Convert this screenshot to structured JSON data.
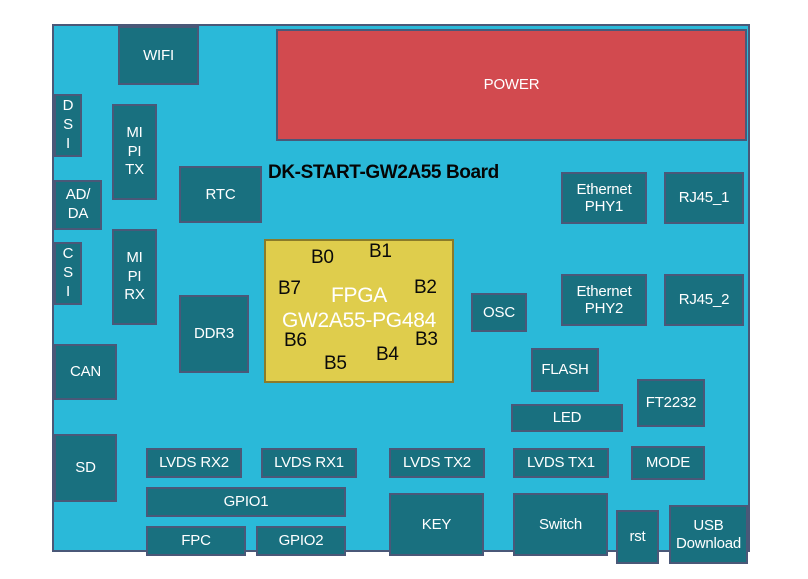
{
  "diagram": {
    "title": "DK-START-GW2A55 Board",
    "board_color": "#2ab9d9",
    "block_color": "#19707f",
    "power_color": "#d24a4f",
    "fpga_color": "#dfcd4c",
    "outline_color": "#4a5878"
  },
  "blocks": {
    "wifi": "WIFI",
    "power": "POWER",
    "dsi": "D\nS\nI",
    "mipi_tx": "MI\nPI\nTX",
    "rtc": "RTC",
    "ethernet_phy1": "Ethernet\nPHY1",
    "rj45_1": "RJ45_1",
    "ad_da": "AD/\nDA",
    "mipi_rx": "MI\nPI\nRX",
    "csi": "C\nS\nI",
    "ddr3": "DDR3",
    "osc": "OSC",
    "ethernet_phy2": "Ethernet\nPHY2",
    "rj45_2": "RJ45_2",
    "can": "CAN",
    "flash": "FLASH",
    "ft2232": "FT2232",
    "led": "LED",
    "sd": "SD",
    "lvds_rx2": "LVDS RX2",
    "lvds_rx1": "LVDS RX1",
    "lvds_tx2": "LVDS TX2",
    "lvds_tx1": "LVDS TX1",
    "mode": "MODE",
    "gpio1": "GPIO1",
    "fpc": "FPC",
    "gpio2": "GPIO2",
    "key": "KEY",
    "switch": "Switch",
    "rst": "rst",
    "usb_download": "USB\nDownload"
  },
  "fpga": {
    "name_line1": "FPGA",
    "name_line2": "GW2A55-PG484",
    "banks": [
      "B0",
      "B1",
      "B2",
      "B3",
      "B4",
      "B5",
      "B6",
      "B7"
    ]
  }
}
